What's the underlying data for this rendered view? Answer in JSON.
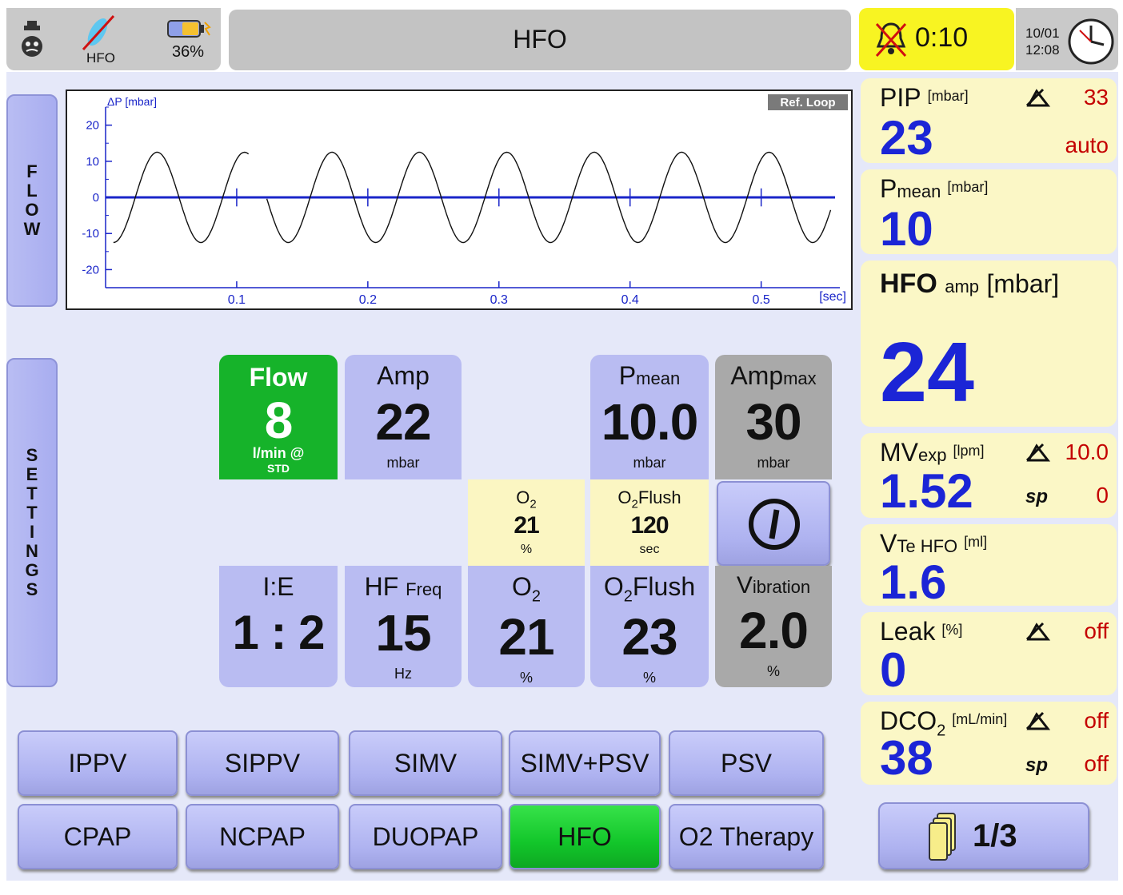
{
  "header": {
    "mode_indicator": "HFO",
    "battery_percent": "36%",
    "title": "HFO",
    "alarm_timer": "0:10",
    "date": "10/01",
    "time": "12:08"
  },
  "side_tabs": {
    "flow": [
      "F",
      "L",
      "O",
      "W"
    ],
    "settings": [
      "S",
      "E",
      "T",
      "T",
      "I",
      "N",
      "G",
      "S"
    ]
  },
  "chart_data": {
    "type": "line",
    "ylabel": "ΔP [mbar]",
    "xlabel": "[sec]",
    "ylim": [
      -25,
      25
    ],
    "xlim": [
      0,
      0.56
    ],
    "y_ticks": [
      "20",
      "10",
      "0",
      "-10",
      "-20"
    ],
    "x_ticks": [
      "0.1",
      "0.2",
      "0.3",
      "0.4",
      "0.5"
    ],
    "ref_loop_label": "Ref. Loop",
    "series": [
      {
        "frequency_hz": 15,
        "amplitude": 12.5,
        "offset": 0,
        "color": "#111111",
        "gap_after": 0.11,
        "gap_until": 0.123
      }
    ],
    "baseline": {
      "value": 0,
      "color": "#1a25c9"
    }
  },
  "settings": {
    "flow": {
      "label": "Flow",
      "value": "8",
      "unit": "l/min @",
      "unit2": "STD"
    },
    "amp": {
      "label": "Amp",
      "value": "22",
      "unit": "mbar"
    },
    "pmean": {
      "label_big": "P",
      "label_small": "mean",
      "value": "10.0",
      "unit": "mbar"
    },
    "ampmax": {
      "label_big": "Amp",
      "label_small": "max",
      "value": "30",
      "unit": "mbar"
    },
    "o2_small": {
      "label": "O",
      "sub": "2",
      "value": "21",
      "unit": "%"
    },
    "o2flush_small": {
      "label": "O",
      "sub": "2",
      "label2": "Flush",
      "value": "120",
      "unit": "sec"
    },
    "ie": {
      "label": "I:E",
      "value": "1 : 2"
    },
    "hffreq": {
      "label_big": "HF",
      "label_small": "Freq",
      "value": "15",
      "unit": "Hz"
    },
    "o2": {
      "label": "O",
      "sub": "2",
      "value": "21",
      "unit": "%"
    },
    "o2flush": {
      "label": "O",
      "sub": "2",
      "label2": "Flush",
      "value": "23",
      "unit": "%"
    },
    "vibration": {
      "label_big": "V",
      "label_small": "ibration",
      "value": "2.0",
      "unit": "%"
    }
  },
  "modes_row1": [
    "IPPV",
    "SIPPV",
    "SIMV",
    "SIMV+PSV",
    "PSV"
  ],
  "modes_row2": [
    "CPAP",
    "NCPAP",
    "DUOPAP",
    "HFO",
    "O2 Therapy"
  ],
  "monitor": {
    "pip": {
      "name": "PIP",
      "unit": "[mbar]",
      "value": "23",
      "limit": "33",
      "mode": "auto"
    },
    "pmean": {
      "name": "P",
      "name_small": "mean",
      "unit": "[mbar]",
      "value": "10"
    },
    "hfoamp": {
      "name": "HFO",
      "name_small": "amp",
      "unit": "[mbar]",
      "value": "24"
    },
    "mvexp": {
      "name": "MV",
      "name_small": "exp",
      "unit": "[lpm]",
      "value": "1.52",
      "limit": "10.0",
      "spont": "0"
    },
    "vtehfo": {
      "name": "V",
      "name_small": "Te HFO",
      "unit": "[ml]",
      "value": "1.6"
    },
    "leak": {
      "name": "Leak",
      "unit": "[%]",
      "value": "0",
      "limit": "off"
    },
    "dco2": {
      "name": "DCO",
      "sub": "2",
      "unit": "[mL/min]",
      "value": "38",
      "limit": "off",
      "spont": "off"
    },
    "page": "1/3",
    "spont_label": "sp"
  },
  "colors": {
    "accent_blue": "#1b25d6",
    "alarm_red": "#c40000",
    "active_green": "#16b32a",
    "alarm_yellow": "#f8f422"
  }
}
